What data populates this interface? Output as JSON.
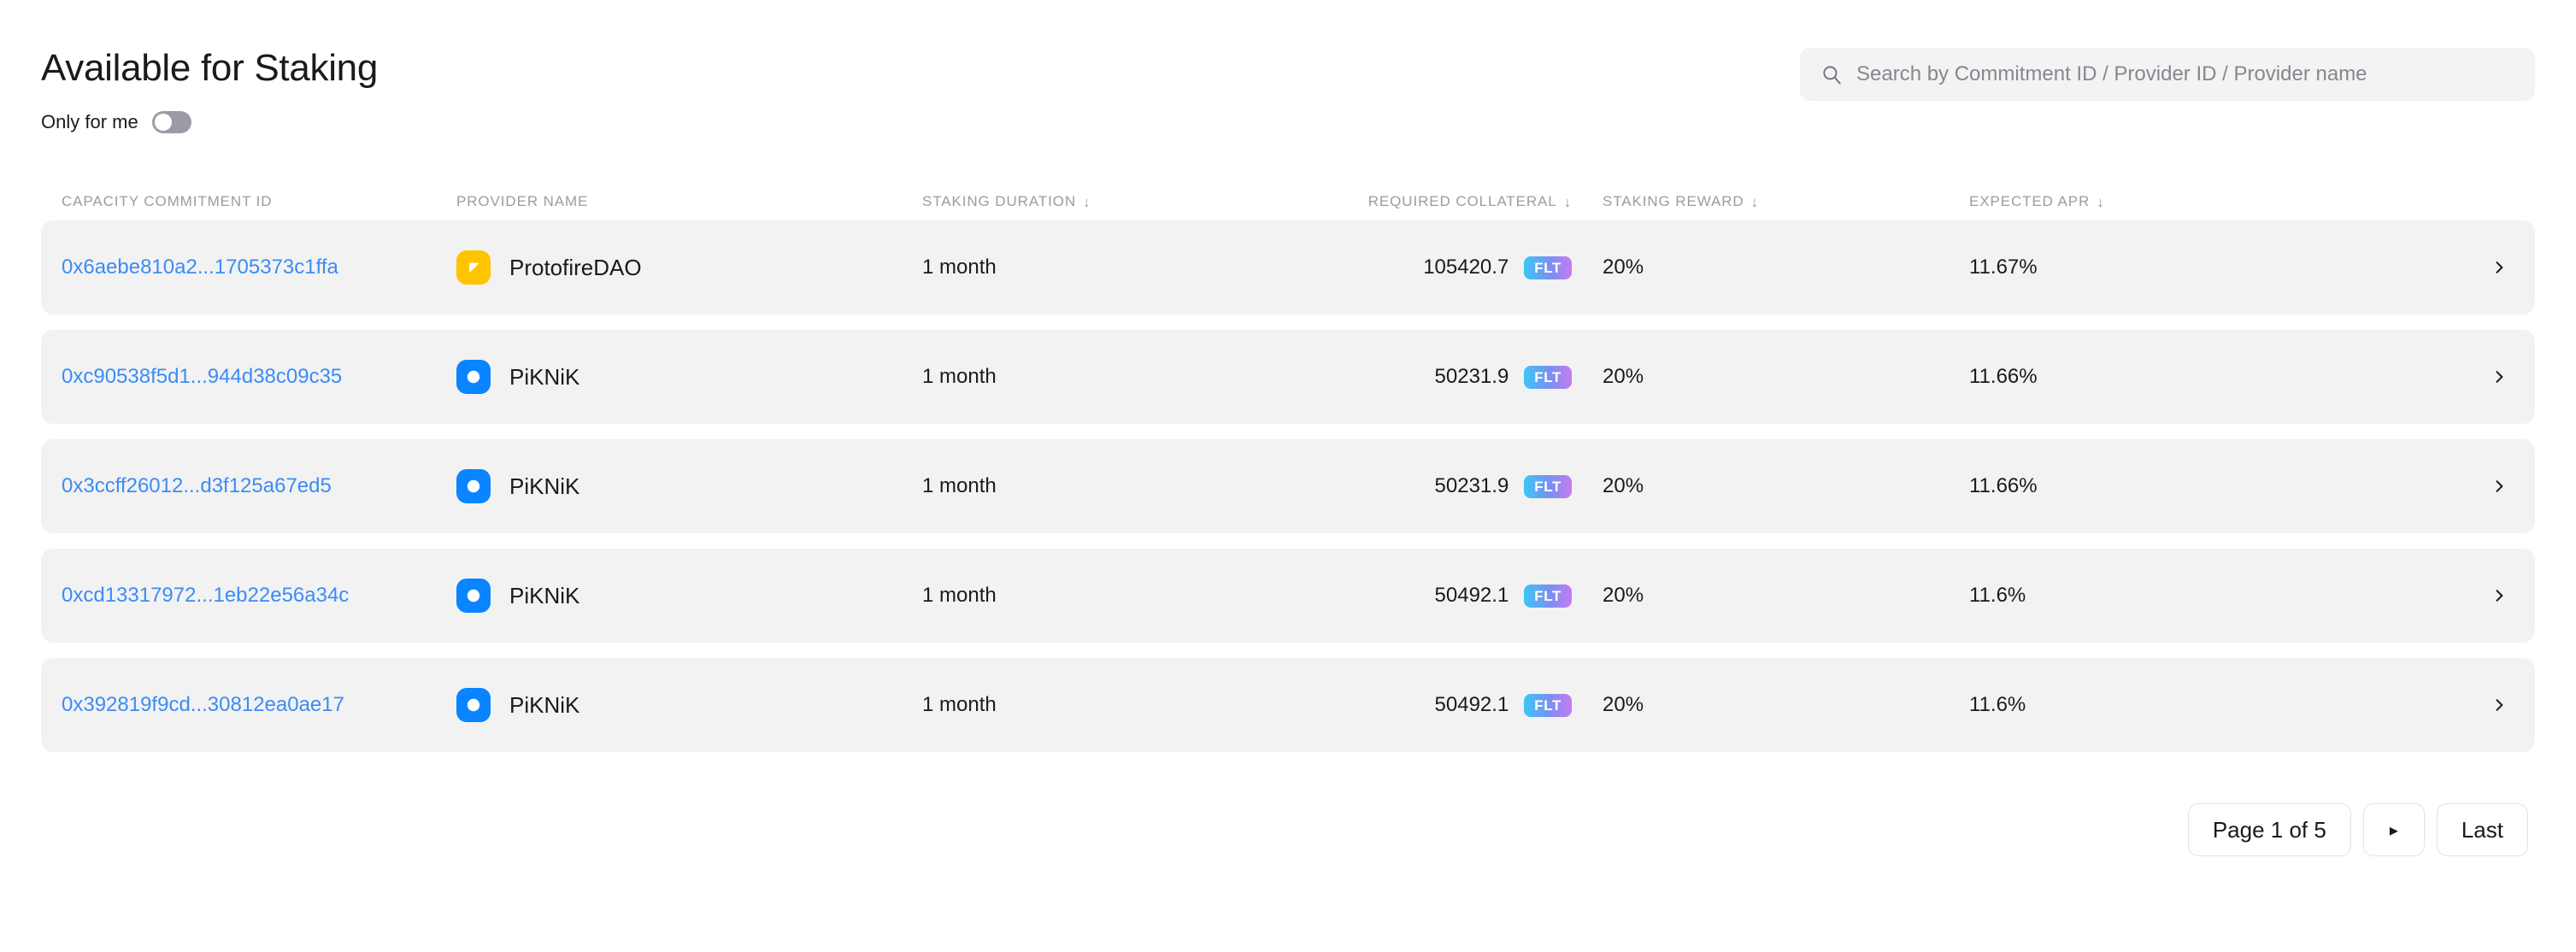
{
  "header": {
    "title": "Available for Staking",
    "only_for_me_label": "Only for me",
    "only_for_me_on": false
  },
  "search": {
    "icon": "search-icon",
    "placeholder": "Search by Commitment ID / Provider ID / Provider name",
    "value": ""
  },
  "table": {
    "columns": [
      {
        "key": "commitment_id",
        "label": "Capacity Commitment ID",
        "sortable": false,
        "sort_arrow": ""
      },
      {
        "key": "provider_name",
        "label": "Provider Name",
        "sortable": false,
        "sort_arrow": ""
      },
      {
        "key": "staking_duration",
        "label": "Staking Duration",
        "sortable": true,
        "sort_arrow": "↓"
      },
      {
        "key": "required_collateral",
        "label": "Required Collateral",
        "sortable": true,
        "sort_arrow": "↓"
      },
      {
        "key": "staking_reward",
        "label": "Staking Reward",
        "sortable": true,
        "sort_arrow": "↓"
      },
      {
        "key": "expected_apr",
        "label": "Expected APR",
        "sortable": true,
        "sort_arrow": "↓"
      }
    ],
    "rows": [
      {
        "commitment_id": "0x6aebe810a2...1705373c1ffa",
        "provider_name": "ProtofireDAO",
        "provider_avatar": "protofiredao-avatar",
        "avatar_color": "#ffc400",
        "staking_duration": "1 month",
        "required_collateral": "105420.7",
        "token": "FLT",
        "staking_reward": "20%",
        "expected_apr": "11.67%",
        "row_chevron": "chevron-right-icon"
      },
      {
        "commitment_id": "0xc90538f5d1...944d38c09c35",
        "provider_name": "PiKNiK",
        "provider_avatar": "piknik-avatar",
        "avatar_color": "#0a84ff",
        "staking_duration": "1 month",
        "required_collateral": "50231.9",
        "token": "FLT",
        "staking_reward": "20%",
        "expected_apr": "11.66%",
        "row_chevron": "chevron-right-icon"
      },
      {
        "commitment_id": "0x3ccff26012...d3f125a67ed5",
        "provider_name": "PiKNiK",
        "provider_avatar": "piknik-avatar",
        "avatar_color": "#0a84ff",
        "staking_duration": "1 month",
        "required_collateral": "50231.9",
        "token": "FLT",
        "staking_reward": "20%",
        "expected_apr": "11.66%",
        "row_chevron": "chevron-right-icon"
      },
      {
        "commitment_id": "0xcd13317972...1eb22e56a34c",
        "provider_name": "PiKNiK",
        "provider_avatar": "piknik-avatar",
        "avatar_color": "#0a84ff",
        "staking_duration": "1 month",
        "required_collateral": "50492.1",
        "token": "FLT",
        "staking_reward": "20%",
        "expected_apr": "11.6%",
        "row_chevron": "chevron-right-icon"
      },
      {
        "commitment_id": "0x392819f9cd...30812ea0ae17",
        "provider_name": "PiKNiK",
        "provider_avatar": "piknik-avatar",
        "avatar_color": "#0a84ff",
        "staking_duration": "1 month",
        "required_collateral": "50492.1",
        "token": "FLT",
        "staking_reward": "20%",
        "expected_apr": "11.6%",
        "row_chevron": "chevron-right-icon"
      }
    ]
  },
  "pagination": {
    "page_label": "Page 1 of 5",
    "next_icon": "▸",
    "last_label": "Last"
  },
  "colors": {
    "link": "#3b8cf5",
    "row_bg": "#f2f2f3",
    "muted": "#9b9ba5",
    "toggle_off": "#9b9ba5"
  }
}
